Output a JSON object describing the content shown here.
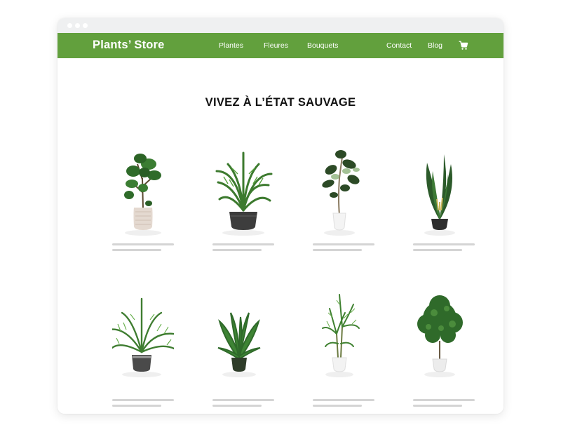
{
  "window": {
    "controls": [
      "dot",
      "dot",
      "dot"
    ]
  },
  "navbar": {
    "brand": "Plants’ Store",
    "links": [
      {
        "label": "Plantes"
      },
      {
        "label": "Fleures"
      },
      {
        "label": "Bouquets"
      },
      {
        "label": "Contact"
      },
      {
        "label": "Blog"
      }
    ],
    "cart_icon": "cart-icon",
    "color": "#62a03d"
  },
  "hero": {
    "title": "VIVEZ À L’ÉTAT SAUVAGE"
  },
  "products": [
    {
      "icon": "fiddle-leaf-fig-plant-icon",
      "pot": "textured beige"
    },
    {
      "icon": "palm-plant-icon",
      "pot": "dark grey"
    },
    {
      "icon": "rubber-plant-icon",
      "pot": "white"
    },
    {
      "icon": "bird-of-paradise-plant-icon",
      "pot": "black"
    },
    {
      "icon": "areca-palm-plant-icon",
      "pot": "grey striped"
    },
    {
      "icon": "strelitzia-plant-icon",
      "pot": "dark green"
    },
    {
      "icon": "kentia-palm-plant-icon",
      "pot": "white"
    },
    {
      "icon": "ficus-tree-plant-icon",
      "pot": "white"
    }
  ]
}
